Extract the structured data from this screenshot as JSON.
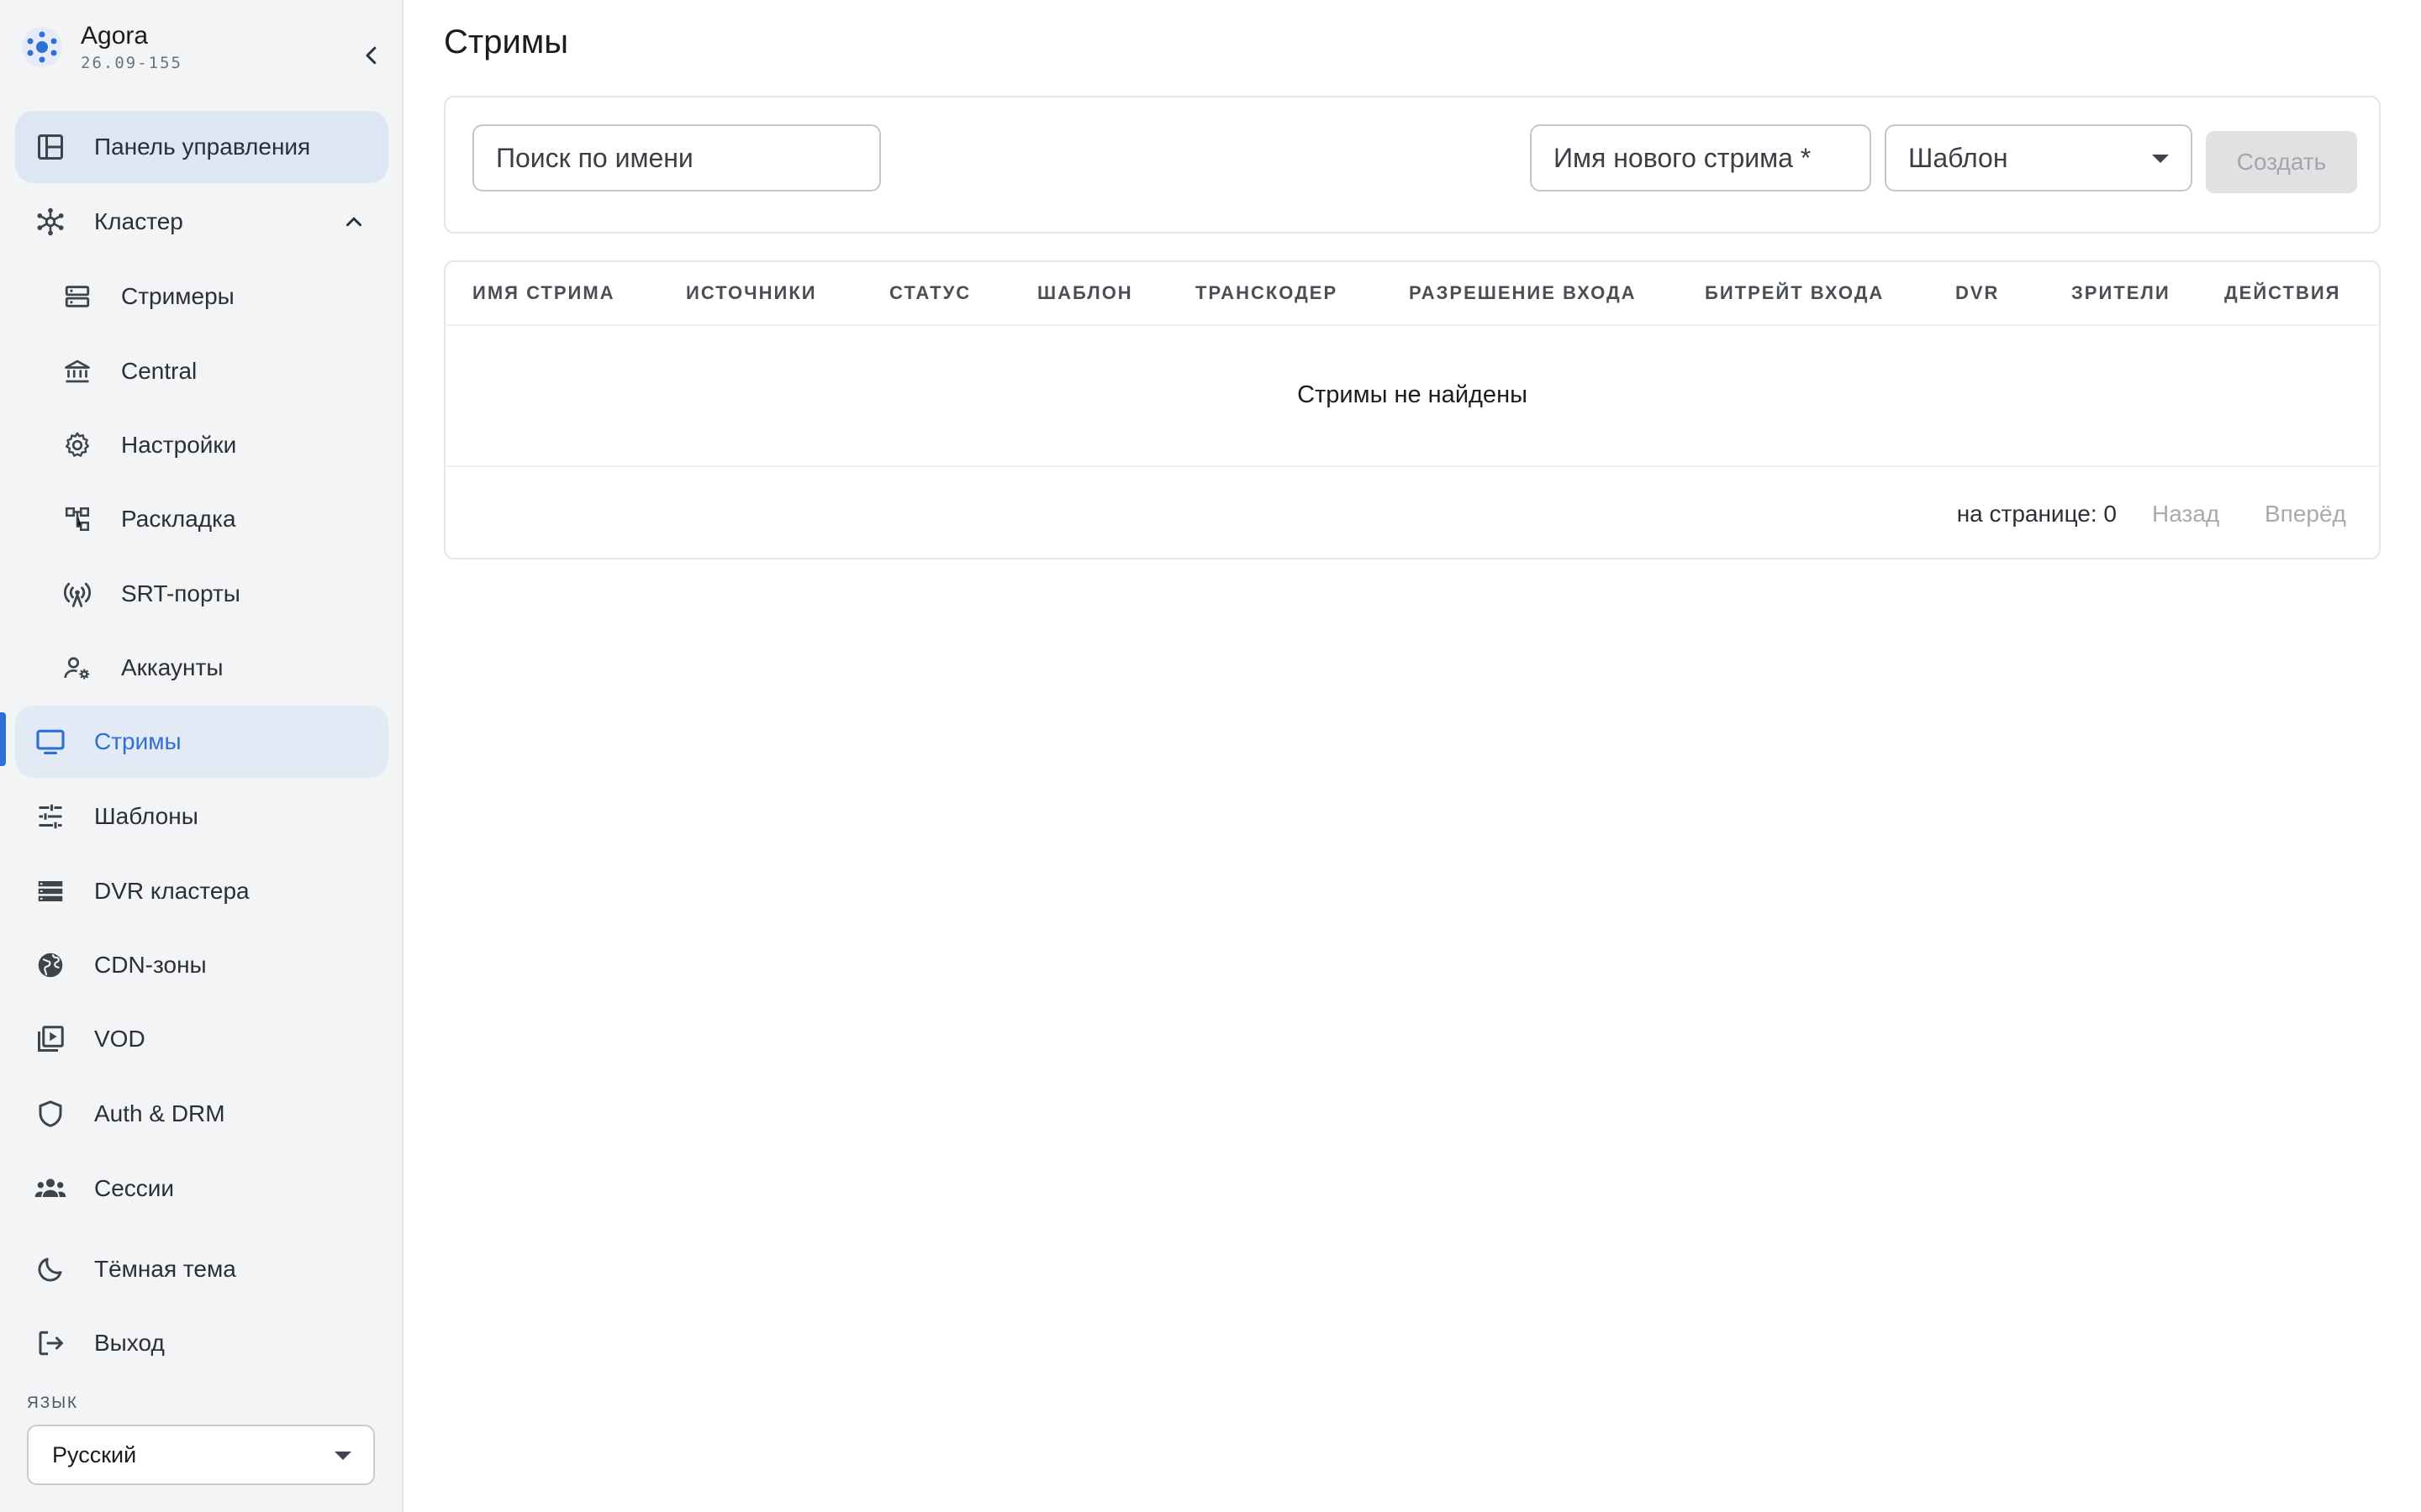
{
  "app": {
    "name": "Agora",
    "version": "26.09-155"
  },
  "sidebar": {
    "items": [
      {
        "label": "Панель управления",
        "icon": "dashboard-icon"
      },
      {
        "label": "Кластер",
        "icon": "cluster-icon",
        "expanded": true
      },
      {
        "label": "Стримеры",
        "icon": "server-icon"
      },
      {
        "label": "Central",
        "icon": "bank-icon"
      },
      {
        "label": "Настройки",
        "icon": "gear-icon"
      },
      {
        "label": "Раскладка",
        "icon": "layout-tree-icon"
      },
      {
        "label": "SRT-порты",
        "icon": "antenna-icon"
      },
      {
        "label": "Аккаунты",
        "icon": "user-settings-icon"
      },
      {
        "label": "Стримы",
        "icon": "monitor-icon",
        "selected": true
      },
      {
        "label": "Шаблоны",
        "icon": "sliders-icon"
      },
      {
        "label": "DVR кластера",
        "icon": "storage-icon"
      },
      {
        "label": "CDN-зоны",
        "icon": "globe-icon"
      },
      {
        "label": "VOD",
        "icon": "video-library-icon"
      },
      {
        "label": "Auth & DRM",
        "icon": "shield-icon"
      },
      {
        "label": "Сессии",
        "icon": "group-icon"
      },
      {
        "label": "Тёмная тема",
        "icon": "moon-icon"
      },
      {
        "label": "Выход",
        "icon": "logout-icon"
      }
    ],
    "language_label": "ЯЗЫК",
    "language_value": "Русский"
  },
  "main": {
    "title": "Стримы",
    "search_placeholder": "Поиск по имени",
    "new_stream_placeholder": "Имя нового стрима *",
    "template_placeholder": "Шаблон",
    "create_button": "Создать",
    "table": {
      "columns": [
        "ИМЯ СТРИМА",
        "ИСТОЧНИКИ",
        "СТАТУС",
        "ШАБЛОН",
        "ТРАНСКОДЕР",
        "РАЗРЕШЕНИЕ ВХОДА",
        "БИТРЕЙТ ВХОДА",
        "DVR",
        "ЗРИТЕЛИ",
        "ДЕЙСТВИЯ"
      ],
      "rows": [],
      "empty_message": "Стримы не найдены"
    },
    "pagination": {
      "per_page": "на странице: 0",
      "prev": "Назад",
      "next": "Вперёд"
    }
  },
  "colors": {
    "accent": "#2f6fd6",
    "sidebar_bg": "#f3f4f6",
    "active_bg": "#dde6f3",
    "disabled_button": "#e0e1e3"
  }
}
